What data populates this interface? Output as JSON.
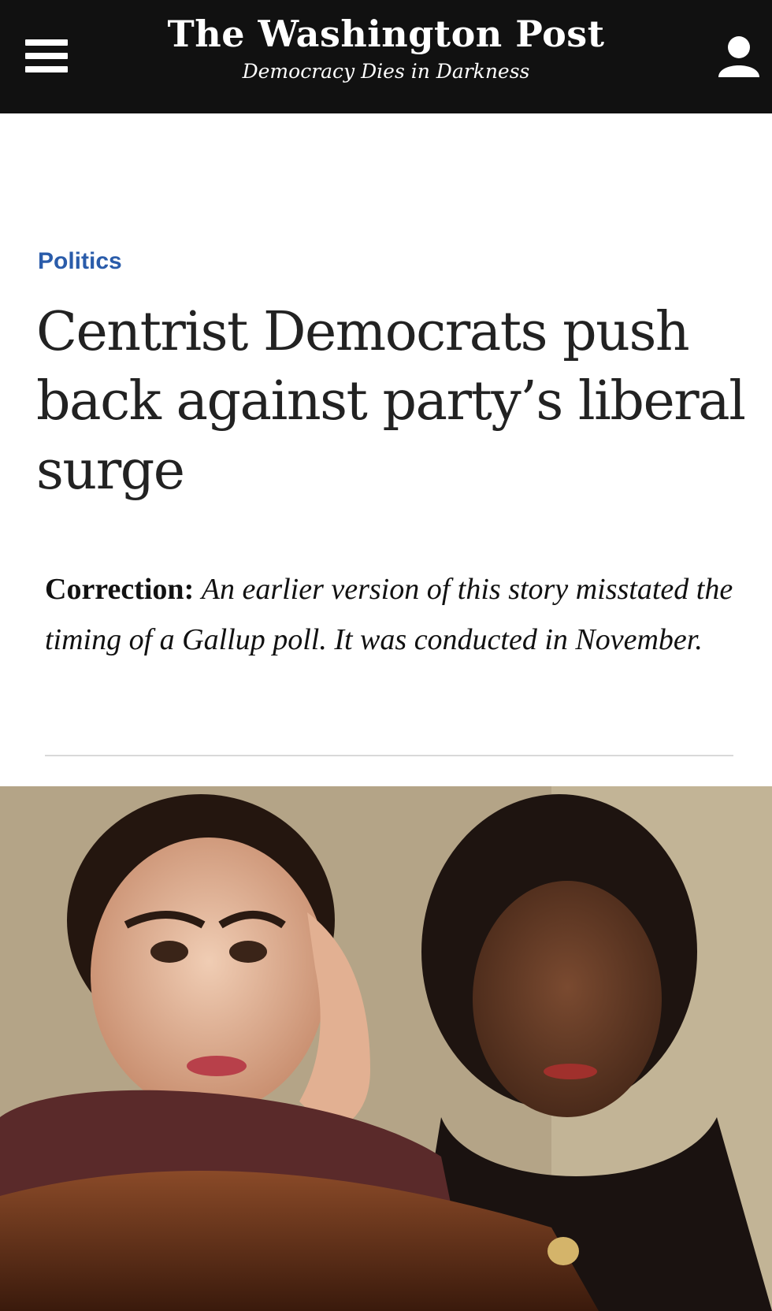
{
  "header": {
    "logo": "The Washington Post",
    "tagline": "Democracy Dies in Darkness",
    "menu_icon": "hamburger-menu-icon",
    "user_icon": "user-icon"
  },
  "article": {
    "section": "Politics",
    "headline": "Centrist Democrats push back against party’s liberal surge",
    "correction_label": "Correction:",
    "correction_text": "An earlier version of this story misstated the timing of a Gallup poll. It was conducted in November."
  },
  "colors": {
    "header_bg": "#111111",
    "section_link": "#2a5caa",
    "headline": "#222222"
  }
}
